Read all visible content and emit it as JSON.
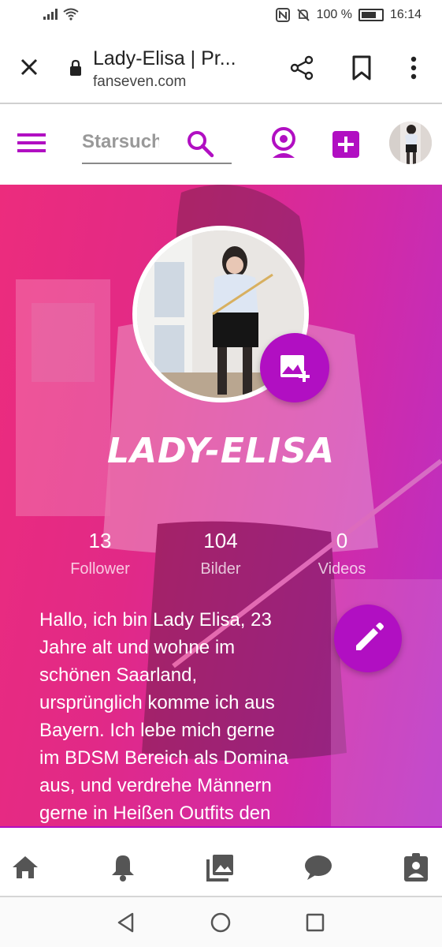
{
  "status_bar": {
    "battery_percent": "100 %",
    "time": "16:14"
  },
  "browser": {
    "title": "Lady-Elisa | Pr...",
    "url": "fanseven.com"
  },
  "header": {
    "search_placeholder": "Starsuche"
  },
  "profile": {
    "name": "LADY-ELISA",
    "stats": [
      {
        "value": "13",
        "label": "Follower"
      },
      {
        "value": "104",
        "label": "Bilder"
      },
      {
        "value": "0",
        "label": "Videos"
      }
    ],
    "bio_lines": [
      "Hallo, ich bin Lady Elisa, 23",
      "Jahre alt und wohne im",
      "schönen Saarland,",
      "ursprünglich komme ich aus",
      "Bayern. Ich lebe mich gerne",
      "im BDSM Bereich als Domina",
      "aus, und verdrehe Männern",
      "gerne in Heißen Outfits den"
    ]
  },
  "colors": {
    "accent": "#b10fc2",
    "hero_start": "#ec2c7d",
    "hero_end": "#b930c6"
  },
  "icons": {
    "close": "close-icon",
    "lock": "lock-icon",
    "share": "share-icon",
    "bookmark": "bookmark-icon",
    "menu": "more-vert-icon",
    "hamburger": "hamburger-menu-icon",
    "search": "search-icon",
    "webcam": "webcam-icon",
    "add": "add-box-icon",
    "add_photo": "add-photo-icon",
    "edit": "pencil-icon",
    "nav": [
      "home-icon",
      "bell-icon",
      "photo-library-icon",
      "chat-icon",
      "assignment-ind-icon"
    ]
  }
}
